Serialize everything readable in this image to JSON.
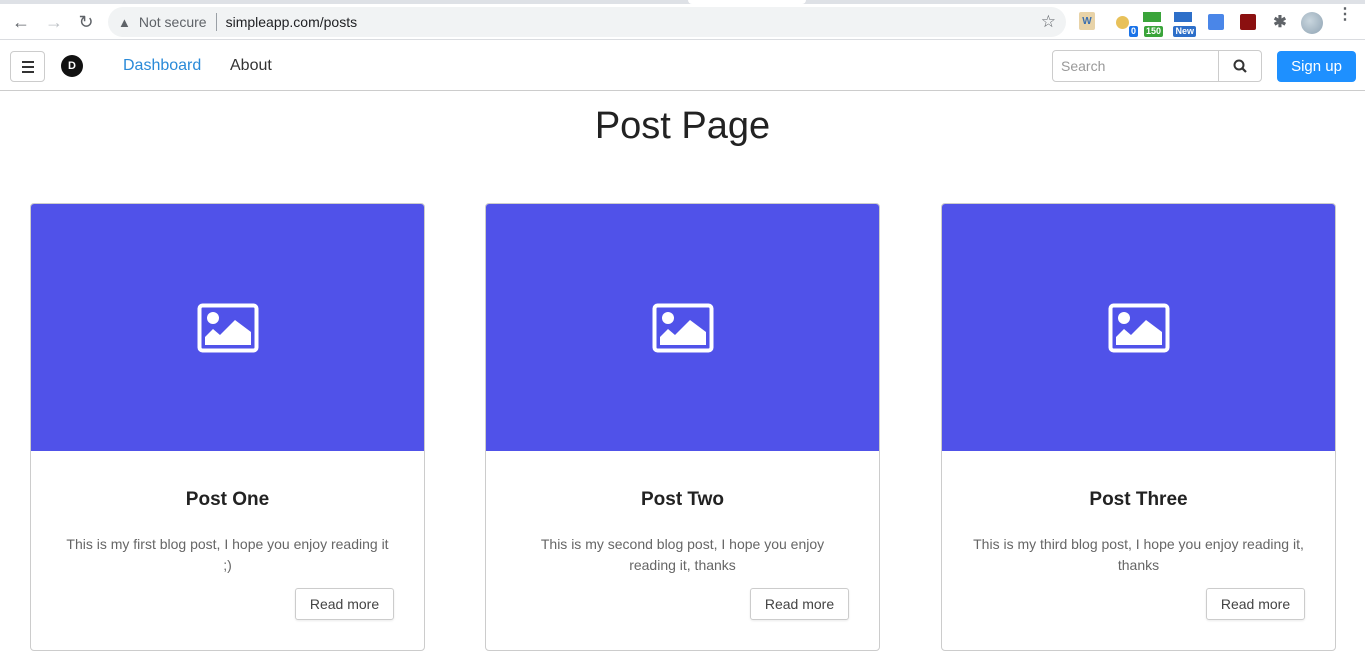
{
  "browser": {
    "security_label": "Not secure",
    "url": "simpleapp.com/posts",
    "extensions": [
      {
        "name": "w-extension",
        "label": "W"
      },
      {
        "name": "pin-extension",
        "badge": "0"
      },
      {
        "name": "counter-extension",
        "badge": "150"
      },
      {
        "name": "new-extension",
        "badge": "New"
      },
      {
        "name": "translate-extension"
      },
      {
        "name": "pdf-extension"
      },
      {
        "name": "puzzle-extension"
      }
    ]
  },
  "navbar": {
    "brand": "D",
    "links": [
      {
        "label": "Dashboard",
        "active": true
      },
      {
        "label": "About",
        "active": false
      }
    ],
    "search": {
      "placeholder": "Search",
      "value": ""
    },
    "signup_label": "Sign up"
  },
  "page": {
    "title": "Post Page",
    "posts": [
      {
        "title": "Post One",
        "text": "This is my first blog post, I hope you enjoy reading it ;)",
        "button": "Read more"
      },
      {
        "title": "Post Two",
        "text": "This is my second blog post, I hope you enjoy reading it, thanks",
        "button": "Read more"
      },
      {
        "title": "Post Three",
        "text": "This is my third blog post, I hope you enjoy reading it, thanks",
        "button": "Read more"
      }
    ]
  },
  "colors": {
    "accent": "#1e90ff",
    "link_active": "#2a8ad8",
    "card_image_bg": "#5052e9"
  }
}
